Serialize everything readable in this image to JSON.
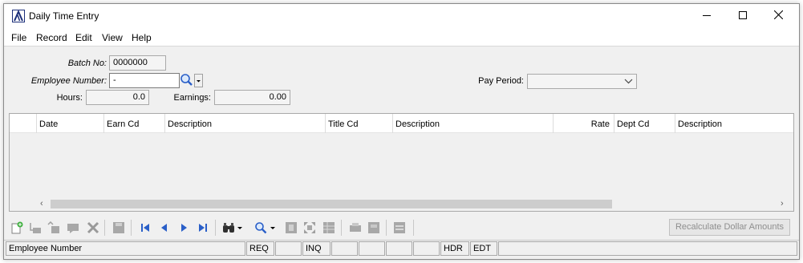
{
  "window": {
    "title": "Daily Time Entry",
    "logo_icon": "accounting-logo-icon",
    "controls": [
      "minimize-icon",
      "maximize-icon",
      "close-icon"
    ]
  },
  "menu": {
    "items": [
      "File",
      "Record",
      "Edit",
      "View",
      "Help"
    ]
  },
  "form": {
    "batch_no_label": "Batch No:",
    "batch_no_value": "0000000",
    "employee_number_label": "Employee Number:",
    "employee_number_value": "-",
    "hours_label": "Hours:",
    "hours_value": "0.0",
    "earnings_label": "Earnings:",
    "earnings_value": "0.00",
    "pay_period_label": "Pay Period:",
    "pay_period_value": ""
  },
  "grid": {
    "columns": [
      "Date",
      "Earn Cd",
      "Description",
      "Title Cd",
      "Description",
      "Rate",
      "Dept Cd",
      "Description"
    ],
    "rows": []
  },
  "toolbar": {
    "icons": [
      "new-record-icon",
      "insert-row-icon",
      "insert-above-icon",
      "comment-icon",
      "delete-icon",
      "save-icon",
      "first-record-icon",
      "previous-record-icon",
      "next-record-icon",
      "last-record-icon",
      "find-binoculars-icon",
      "lookup-magnifier-icon",
      "grid-view-icon",
      "expand-icon",
      "table-icon",
      "print-icon",
      "print-preview-icon",
      "options-icon"
    ],
    "recalc_label": "Recalculate Dollar Amounts"
  },
  "status": {
    "field_name": "Employee Number",
    "req": "REQ",
    "inq": "INQ",
    "hdr": "HDR",
    "edt": "EDT"
  },
  "colors": {
    "window_bg": "#f0f0f0",
    "logo_blue": "#1c2f7a",
    "disabled_text": "#8e8e8e",
    "nav_blue": "#2a5fc8"
  }
}
